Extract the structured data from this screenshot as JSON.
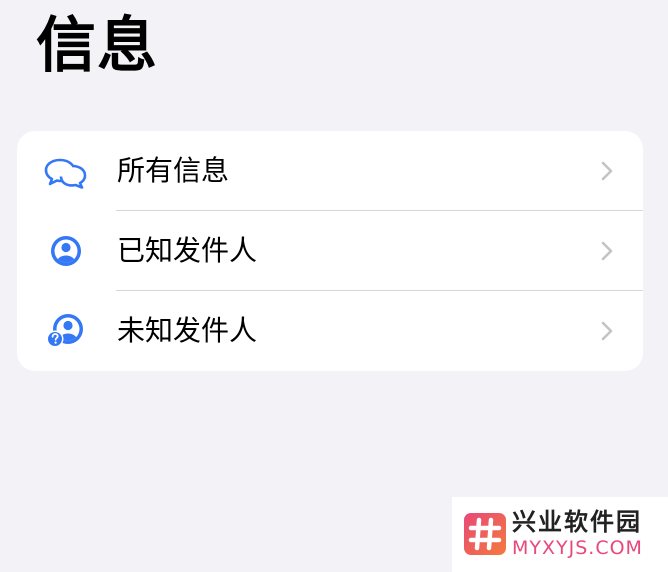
{
  "header": {
    "title": "信息"
  },
  "filter_list": {
    "items": [
      {
        "label": "所有信息",
        "icon": "chat-bubbles-icon"
      },
      {
        "label": "已知发件人",
        "icon": "person-circle-icon"
      },
      {
        "label": "未知发件人",
        "icon": "unknown-person-icon"
      }
    ],
    "chevron_icon": "chevron-right-icon"
  },
  "watermark": {
    "name": "兴业软件园",
    "domain": "MYXYJS.COM",
    "logo_icon": "hash-logo-icon"
  },
  "colors": {
    "background": "#f2f2f7",
    "card": "#ffffff",
    "accent": "#3478f6",
    "chevron": "#c4c4c6",
    "divider": "#d6d6da",
    "watermark_pink": "#e8487a",
    "watermark_orange": "#f47a3c"
  }
}
